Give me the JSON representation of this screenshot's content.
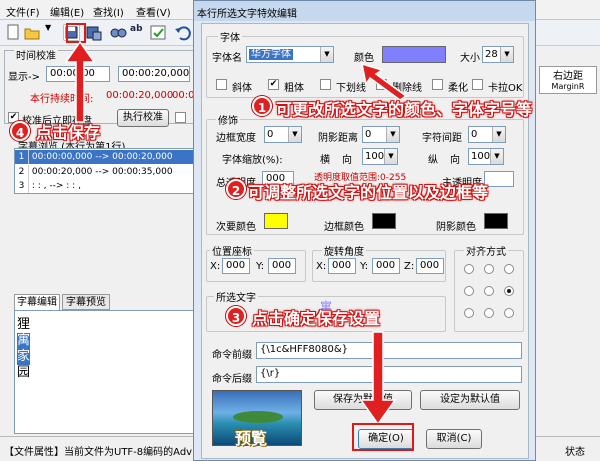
{
  "main": {
    "menu": [
      "文件(F)",
      "编辑(E)",
      "查找(I)",
      "查看(V)"
    ],
    "sync_group_label": "时间校准",
    "display_label": "显示->",
    "time_a": "00:00:00",
    "time_b": "00:00:20,000",
    "duration_label": "本行持续时间:",
    "duration_value": "00:00:20,000",
    "duration_value2": "00:0",
    "sync_save_label": "校准后立即存盘",
    "run_sync_label": "执行校准",
    "browse_header": "字幕浏览 (本行为第1行)",
    "rows": [
      {
        "num": "1",
        "text": "00:00:00,000 --> 00:00:20,000"
      },
      {
        "num": "2",
        "text": "00:00:20,000 --> 00:00:35,000"
      },
      {
        "num": "3",
        "text": " :  :  ,    -->  :  :  ,"
      }
    ],
    "tab_edit": "字幕编辑",
    "tab_preview": "字幕预览",
    "editor_lines": [
      "狸",
      "寓",
      "家",
      "园"
    ],
    "right_header": "右边距",
    "right_sub": "MarginR",
    "status_text": "【文件属性】当前文件为UTF-8编码的Adv",
    "status_right": "状态"
  },
  "dialog": {
    "title": "本行所选文字特效编辑",
    "font_group": "字体",
    "font_name_label": "字体名",
    "font_name_value": "华方字体",
    "color_label": "颜色",
    "size_label": "大小",
    "size_value": "28",
    "checkboxes": [
      {
        "label": "斜体",
        "checked": false
      },
      {
        "label": "粗体",
        "checked": true
      },
      {
        "label": "下划线",
        "checked": false
      },
      {
        "label": "删除线",
        "checked": false
      },
      {
        "label": "柔化",
        "checked": false
      },
      {
        "label": "卡拉OK",
        "checked": false
      }
    ],
    "decor_group": "修饰",
    "border_width_label": "边框宽度",
    "border_width_value": "0",
    "shadow_dist_label": "阴影距离",
    "shadow_dist_value": "0",
    "char_spacing_label": "字符间距",
    "char_spacing_value": "0",
    "scale_label": "字体缩放(%):",
    "horiz_label": "横",
    "horiz_dir_label": "向",
    "horiz_value": "100",
    "vert_label": "纵",
    "vert_dir_label": "向",
    "vert_value": "100",
    "total_opacity_label": "总透明度",
    "total_opacity_value": "000",
    "opacity_hint": "透明度取值范围:0-255",
    "main_opacity_label": "主透明度",
    "secondary_color_label": "次要颜色",
    "border_color_label": "边框颜色",
    "shadow_color_label": "阴影颜色",
    "pos_group": "位置座标",
    "pos_x_label": "X:",
    "pos_x": "000",
    "pos_y_label": "Y:",
    "pos_y": "000",
    "rot_group": "旋转角度",
    "rot_x_label": "X:",
    "rot_x": "000",
    "rot_y_label": "Y:",
    "rot_y": "000",
    "rot_z_label": "Z:",
    "rot_z": "000",
    "align_group": "对齐方式",
    "selected_group": "所选文字",
    "selected_text": "寓",
    "prefix_label": "命令前缀",
    "prefix_value": "{\\1c&HFF8080&}",
    "suffix_label": "命令后缀",
    "suffix_value": "{\\r}",
    "save_default_label": "保存为默认值",
    "set_default_label": "设定为默认值",
    "preview_text": "预覧",
    "ok_label": "确定(O)",
    "cancel_label": "取消(C)"
  },
  "colors": {
    "primary": "#8080ff",
    "secondary": "#ffff00",
    "border": "#000000",
    "shadow": "#000000",
    "annotation": "#e02020"
  },
  "annotations": {
    "step1_num": "1",
    "step1_text": "可更改所选文字的颜色、字体字号等",
    "step2_num": "2",
    "step2_text": "可调整所选文字的位置以及边框等",
    "step3_num": "3",
    "step3_text": "点击确定保存设置",
    "step4_num": "4",
    "step4_text": "点击保存"
  },
  "icons": [
    "new-icon",
    "open-icon",
    "save-icon",
    "save-as-icon",
    "find-icon",
    "replace-icon",
    "spellcheck-icon",
    "undo-icon"
  ]
}
